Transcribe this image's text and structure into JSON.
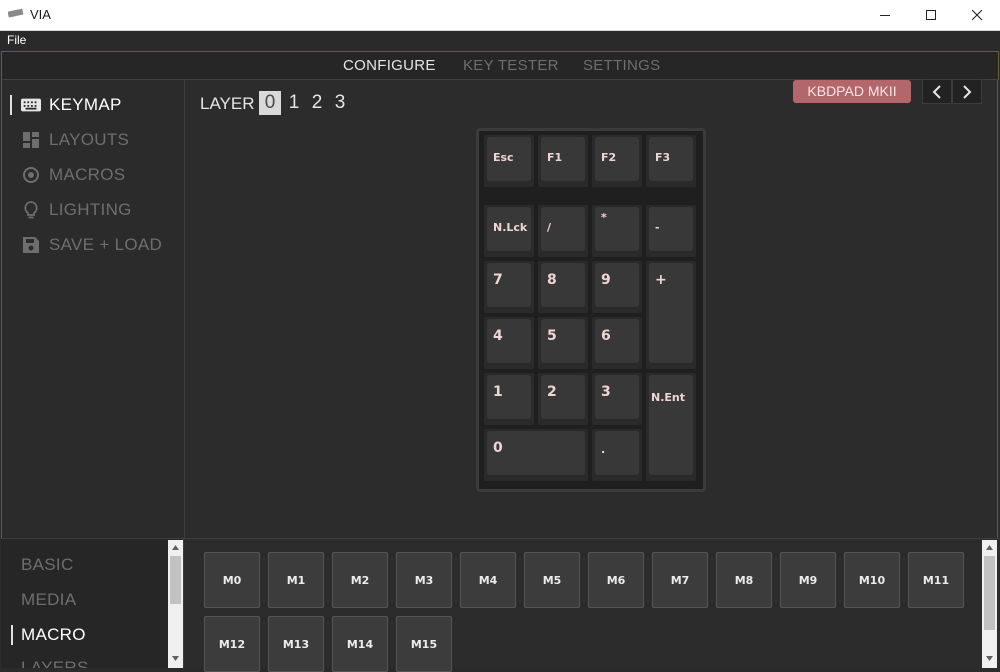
{
  "window": {
    "title": "VIA"
  },
  "menu": {
    "file": "File"
  },
  "top_tabs": {
    "configure": "CONFIGURE",
    "key_tester": "KEY TESTER",
    "settings": "SETTINGS"
  },
  "sidebar": {
    "items": [
      {
        "label": "KEYMAP",
        "icon": "keyboard-icon",
        "active": true
      },
      {
        "label": "LAYOUTS",
        "icon": "layouts-icon",
        "active": false
      },
      {
        "label": "MACROS",
        "icon": "macros-icon",
        "active": false
      },
      {
        "label": "LIGHTING",
        "icon": "lightbulb-icon",
        "active": false
      },
      {
        "label": "SAVE + LOAD",
        "icon": "save-icon",
        "active": false
      }
    ]
  },
  "layers": {
    "label": "LAYER",
    "numbers": [
      "0",
      "1",
      "2",
      "3"
    ],
    "selected": "0"
  },
  "device": {
    "name": "KBDPAD MKII"
  },
  "numpad": {
    "keys": [
      "Esc",
      "F1",
      "F2",
      "F3",
      "N.Lck",
      "/",
      "*",
      "-",
      "7",
      "8",
      "9",
      "+",
      "4",
      "5",
      "6",
      "1",
      "2",
      "3",
      "N.Ent",
      "0",
      "."
    ]
  },
  "categories": {
    "items": [
      "BASIC",
      "MEDIA",
      "MACRO",
      "LAYERS"
    ],
    "active": "MACRO"
  },
  "macro_keys": [
    "M0",
    "M1",
    "M2",
    "M3",
    "M4",
    "M5",
    "M6",
    "M7",
    "M8",
    "M9",
    "M10",
    "M11",
    "M12",
    "M13",
    "M14",
    "M15"
  ],
  "colors": {
    "background": "#2c2c2c",
    "badge": "#b3676b",
    "key_legend": "#f0d6d2",
    "active_text": "#ffffff",
    "inactive_text": "#6e6e6e"
  }
}
